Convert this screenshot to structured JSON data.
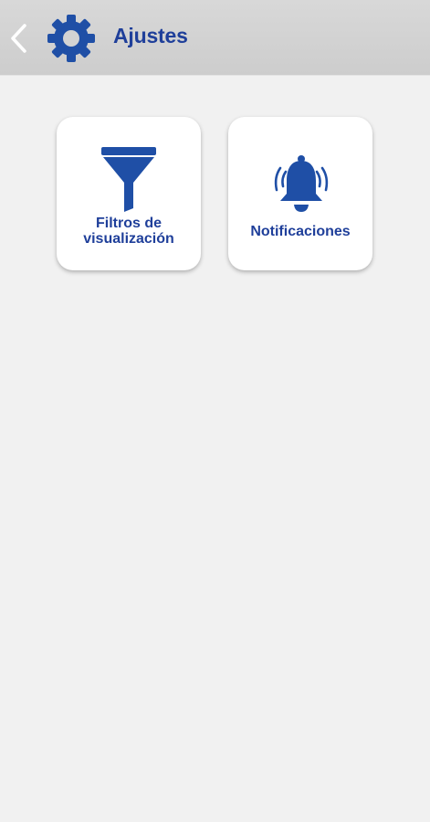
{
  "header": {
    "title": "Ajustes",
    "back_icon": "chevron-left-icon",
    "settings_icon": "gear-icon"
  },
  "tiles": [
    {
      "label_line1": "Filtros de",
      "label_line2": "visualización",
      "icon": "funnel-icon"
    },
    {
      "label": "Notificaciones",
      "icon": "bell-ringing-icon"
    }
  ],
  "colors": {
    "primary": "#1f3f9a",
    "header_bg": "#d3d3d3",
    "page_bg": "#f1f1f1",
    "tile_bg": "#ffffff"
  }
}
